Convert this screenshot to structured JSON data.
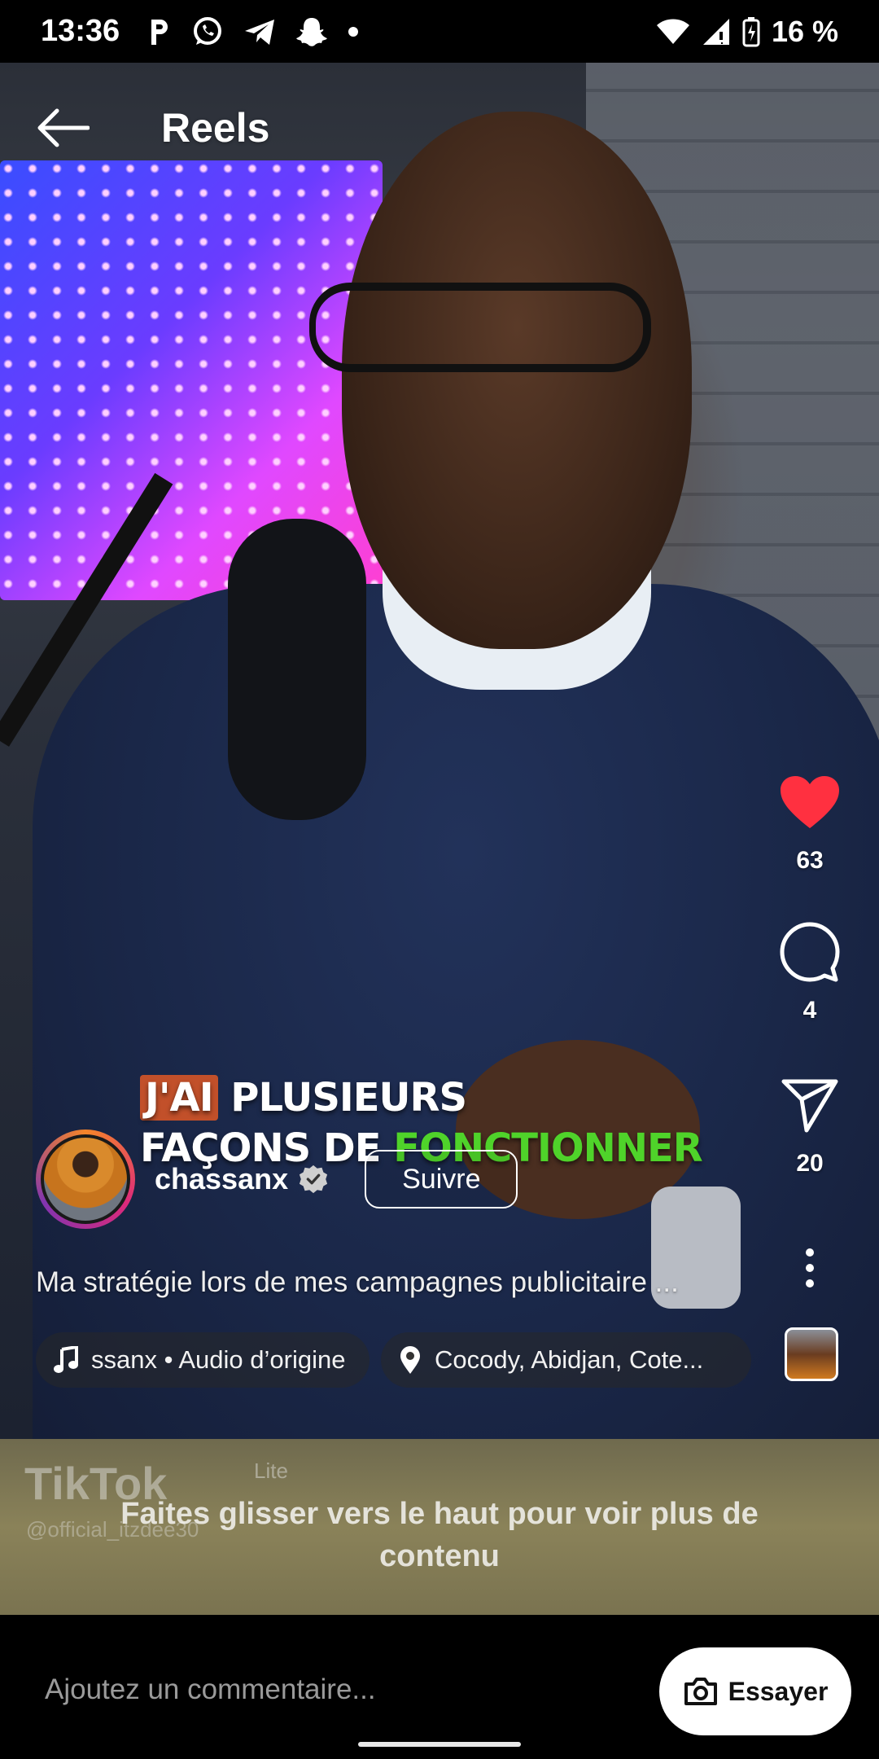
{
  "status_bar": {
    "time": "13:36",
    "battery": "16 %",
    "icons": [
      "parking-icon",
      "whatsapp-icon",
      "telegram-icon",
      "snapchat-icon",
      "dot-icon",
      "wifi-icon",
      "signal-icon",
      "battery-icon"
    ]
  },
  "header": {
    "title": "Reels"
  },
  "video": {
    "caption_line1_highlight": "J'AI",
    "caption_line1_rest": "PLUSIEURS",
    "caption_line2_start": "FAÇONS DE ",
    "caption_line2_green": "FONCTIONNER"
  },
  "actions": {
    "likes": "63",
    "comments": "4",
    "shares": "20"
  },
  "author": {
    "username": "chassanx",
    "follow_label": "Suivre"
  },
  "description": "Ma stratégie lors de mes campagnes publicitaire ...",
  "chips": {
    "audio": "ssanx • Audio d’origine",
    "location": "Cocody, Abidjan, Cote..."
  },
  "next_reel": {
    "watermark": "TikTok",
    "watermark_badge": "Lite",
    "watermark_handle": "@official_itzdee30",
    "swipe_hint": "Faites glisser vers le haut pour voir plus de contenu"
  },
  "comment_bar": {
    "placeholder": "Ajoutez un commentaire...",
    "try_label": "Essayer"
  },
  "colors": {
    "like_red": "#ff3040",
    "caption_green": "#4fd32a",
    "caption_highlight": "#c2502a"
  }
}
